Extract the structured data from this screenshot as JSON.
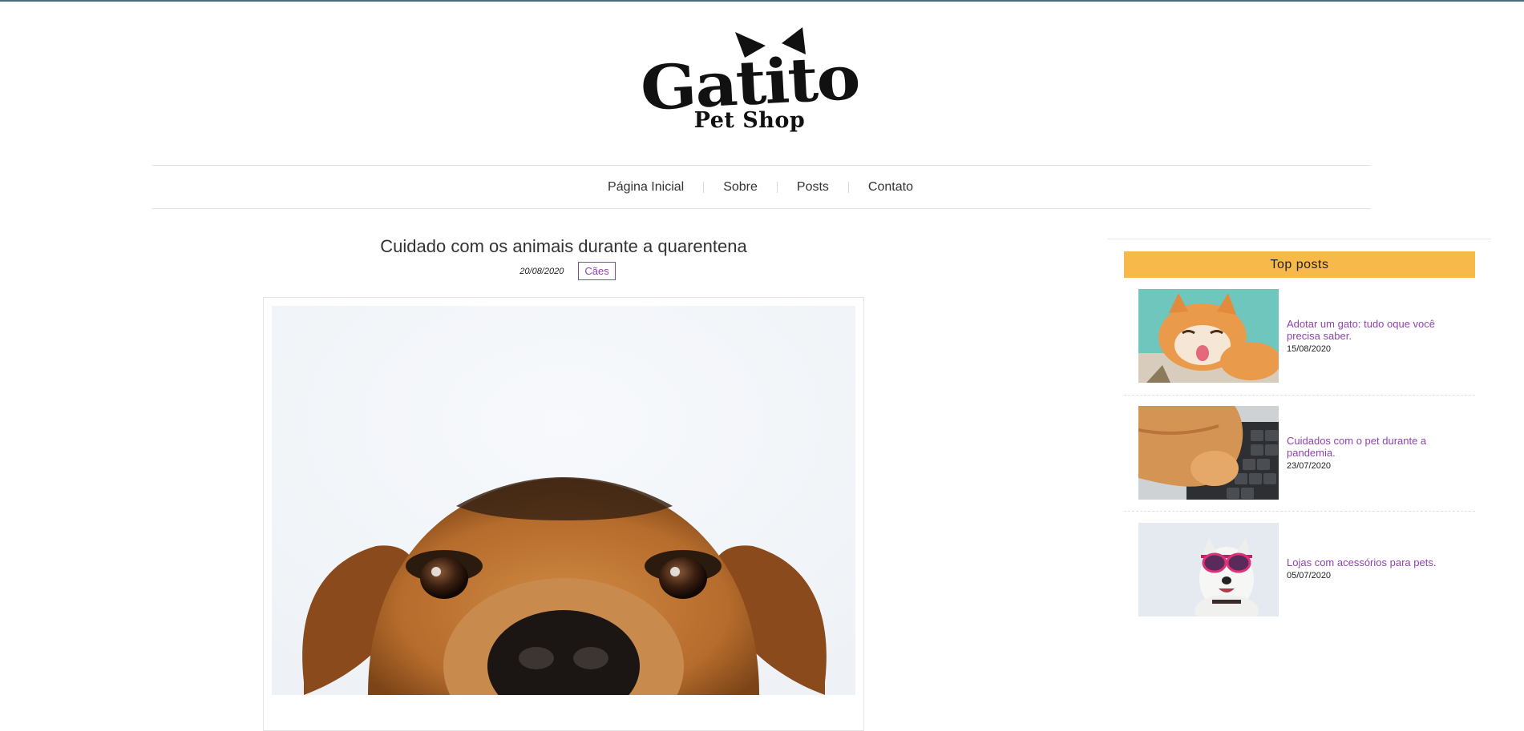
{
  "logo": {
    "brand": "Gatito",
    "subtitle": "Pet Shop"
  },
  "nav": {
    "items": [
      {
        "label": "Página Inicial"
      },
      {
        "label": "Sobre"
      },
      {
        "label": "Posts"
      },
      {
        "label": "Contato"
      }
    ]
  },
  "article": {
    "title": "Cuidado com os animais durante a quarentena",
    "date": "20/08/2020",
    "tag": "Cães",
    "image_icon": "dog-photo"
  },
  "sidebar": {
    "heading": "Top posts",
    "posts": [
      {
        "title": "Adotar um gato: tudo oque você precisa saber.",
        "date": "15/08/2020",
        "image_icon": "cat-photo"
      },
      {
        "title": "Cuidados com o pet durante a pandemia.",
        "date": "23/07/2020",
        "image_icon": "cat-paw-keyboard-photo"
      },
      {
        "title": "Lojas com acessórios para pets.",
        "date": "05/07/2020",
        "image_icon": "dog-sunglasses-photo"
      }
    ]
  },
  "colors": {
    "accent_purple": "#8e44ad",
    "top_posts_bg": "#f8b94b"
  }
}
